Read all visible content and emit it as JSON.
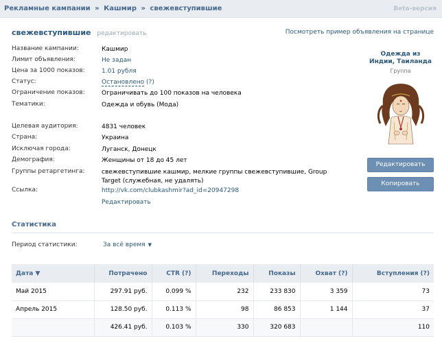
{
  "breadcrumb": {
    "root": "Рекламные кампании",
    "sep": "»",
    "campaign": "Кашмир",
    "ad": "свежевступившие"
  },
  "beta_label": "Beta-версия",
  "ad_header": {
    "name": "свежевступившие",
    "edit_label": "редактировать",
    "preview_link": "Посмотреть пример объявления на странице"
  },
  "props": {
    "campaign": {
      "label": "Название кампании:",
      "value": "Кашмир"
    },
    "limit": {
      "label": "Лимит объявления:",
      "value": "Не задан"
    },
    "price": {
      "label": "Цена за 1000 показов:",
      "value": "1.01 рубля"
    },
    "status": {
      "label": "Статус:",
      "value": "Остановлено",
      "help": "(?)"
    },
    "impression_limit": {
      "label": "Ограничение показов:",
      "value": "Ограничивать до 100 показов на человека"
    },
    "topics": {
      "label": "Тематики:",
      "value": "Одежда и обувь (Мода)"
    },
    "audience": {
      "label": "Целевая аудитория:",
      "value": "4831 человек"
    },
    "country": {
      "label": "Страна:",
      "value": "Украина"
    },
    "exclude_cities": {
      "label": "Исключая города:",
      "value": "Луганск, Донецк"
    },
    "demography": {
      "label": "Демография:",
      "value": "Женщины от 18 до 45 лет"
    },
    "retargeting": {
      "label": "Группы ретаргетинга:",
      "value": "свежевступившие кашмир, мелкие группы свежевступившие, Group Target (служебная, не удалять)"
    },
    "link": {
      "label": "Ссылка:",
      "value": "http://vk.com/clubkashmir?ad_id=20947298"
    },
    "edit_link": "Редактировать"
  },
  "ad_preview": {
    "title": "Одежда из Индии, Таиланда",
    "subtitle": "Группа",
    "image_icon": "girl-illustration"
  },
  "buttons": {
    "edit": "Редактировать",
    "copy": "Копировать"
  },
  "stats": {
    "title": "Статистика",
    "period_label": "Период статистики:",
    "period_value": "За всё время",
    "columns": [
      "Дата ▼",
      "Потрачено",
      "CTR (?)",
      "Переходы",
      "Показы",
      "Охват (?)",
      "Вступления (?)"
    ],
    "rows": [
      [
        "Май 2015",
        "297.91 руб.",
        "0.099 %",
        "232",
        "233 830",
        "3 359",
        "73"
      ],
      [
        "Апрель 2015",
        "128.50 руб.",
        "0.113 %",
        "98",
        "86 853",
        "1 144",
        "37"
      ]
    ],
    "total": [
      "",
      "426.41 руб.",
      "0.103 %",
      "330",
      "320 683",
      "",
      "110"
    ]
  },
  "colors": {
    "link": "#2b587a",
    "header": "#45688e",
    "button": "#6d8fb3",
    "bar": "#e9edf1"
  }
}
